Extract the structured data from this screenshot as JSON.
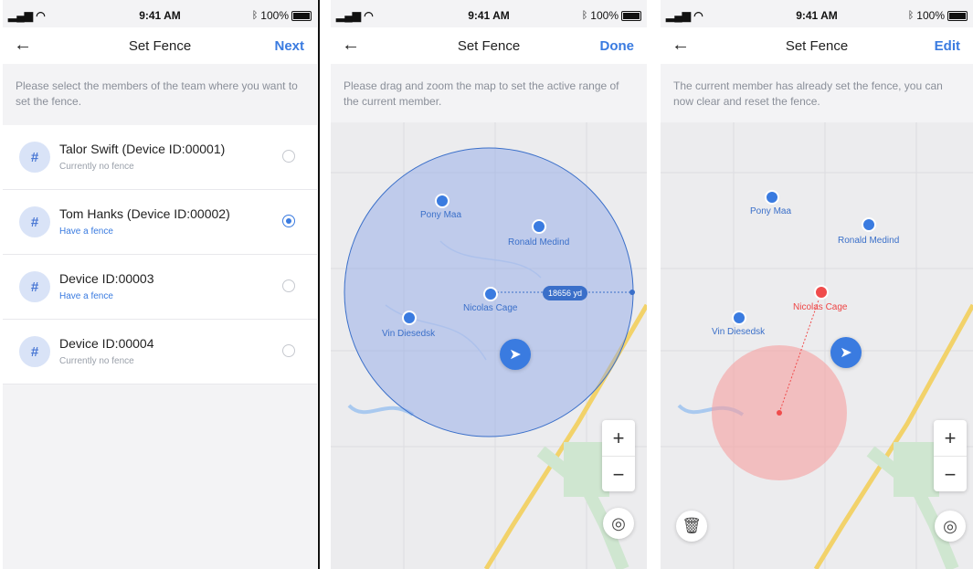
{
  "status": {
    "time": "9:41 AM",
    "battery": "100%"
  },
  "screen1": {
    "title": "Set Fence",
    "action": "Next",
    "hint": "Please select the members of the team where you want to set the fence.",
    "members": [
      {
        "name": "Talor Swift (Device ID:00001)",
        "status": "Currently no fence",
        "selected": false
      },
      {
        "name": "Tom Hanks (Device ID:00002)",
        "status": "Have a fence",
        "selected": true
      },
      {
        "name": "Device ID:00003",
        "status": "Have a fence",
        "selected": false
      },
      {
        "name": "Device ID:00004",
        "status": "Currently no fence",
        "selected": false
      }
    ]
  },
  "screen2": {
    "title": "Set Fence",
    "action": "Done",
    "hint": "Please drag and zoom the map to set the active range of the current member.",
    "people": [
      "Pony Maa",
      "Ronald Medind",
      "Nicolas Cage",
      "Vin Diesedsk"
    ],
    "distance": "18656 yd",
    "zoom_in": "+",
    "zoom_out": "−"
  },
  "screen3": {
    "title": "Set Fence",
    "action": "Edit",
    "hint": "The current member has already set the fence, you can now clear and reset the fence.",
    "people": [
      "Pony Maa",
      "Ronald Medind",
      "Nicolas Cage",
      "Vin Diesedsk"
    ],
    "zoom_in": "+",
    "zoom_out": "−"
  },
  "colors": {
    "accent": "#3a7be0",
    "fence_blue": "#8aa4e6",
    "fence_red": "#f6a0a0",
    "alert": "#f04c4c"
  }
}
